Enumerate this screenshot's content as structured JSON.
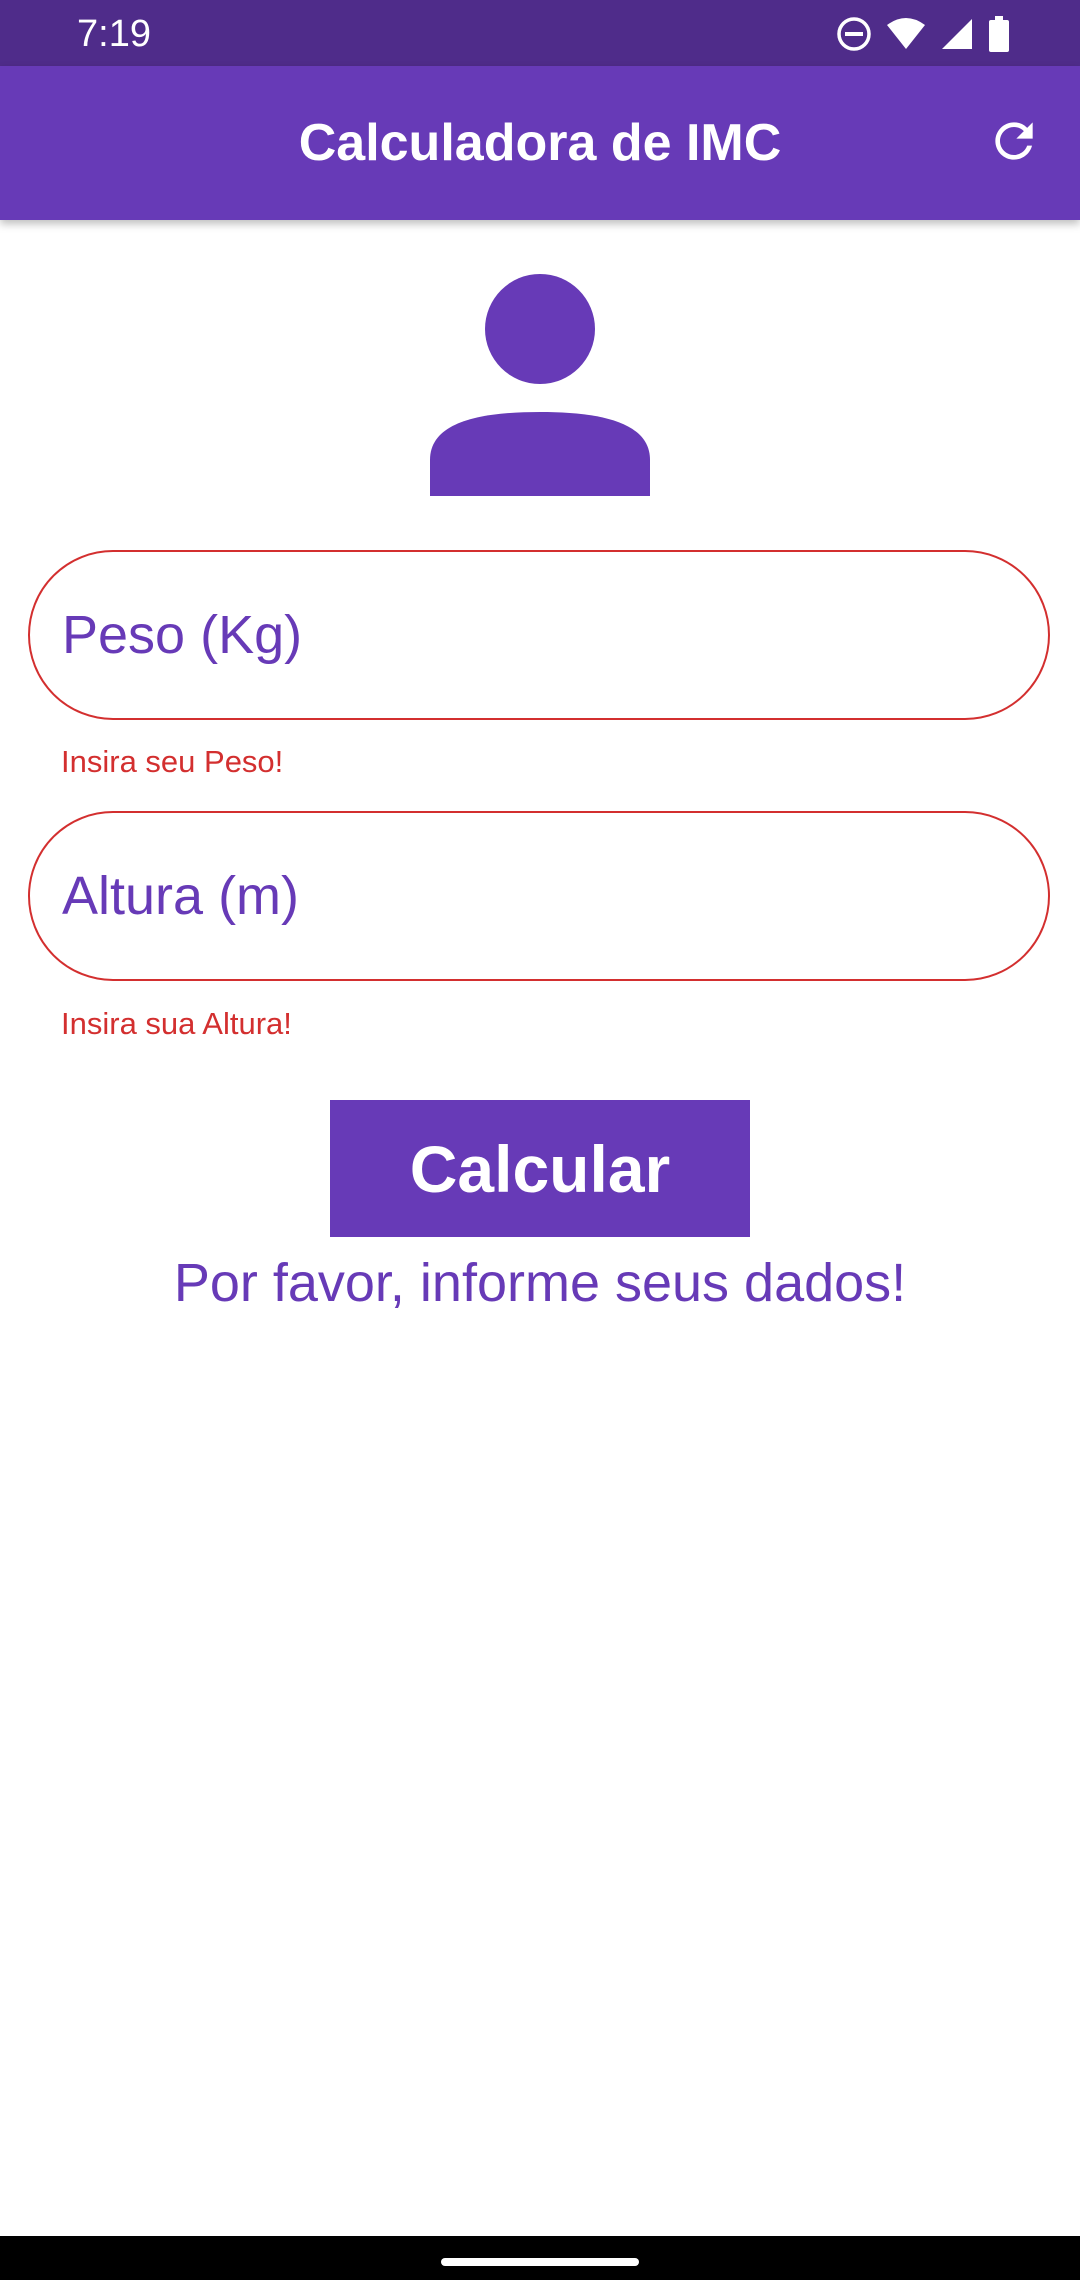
{
  "status_bar": {
    "time": "7:19",
    "icons": [
      "do-not-disturb-icon",
      "wifi-icon",
      "signal-icon",
      "battery-icon"
    ]
  },
  "app_bar": {
    "title": "Calculadora de IMC",
    "refresh_icon": "refresh-icon"
  },
  "avatar": {
    "icon": "person-icon"
  },
  "form": {
    "weight": {
      "placeholder": "Peso (Kg)",
      "value": "",
      "error": "Insira seu Peso!"
    },
    "height": {
      "placeholder": "Altura (m)",
      "value": "",
      "error": "Insira sua Altura!"
    },
    "calculate_label": "Calcular",
    "info": "Por favor, informe seus dados!"
  },
  "colors": {
    "primary": "#673ab7",
    "status_bar": "#4f2c8a",
    "error": "#d32f2f"
  }
}
